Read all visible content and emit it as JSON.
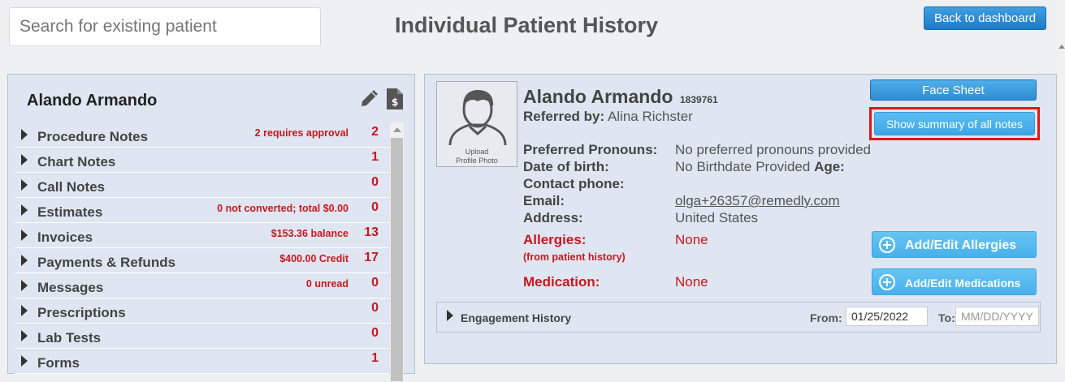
{
  "search": {
    "placeholder": "Search for existing patient"
  },
  "header": {
    "title": "Individual Patient History",
    "back_label": "Back to dashboard"
  },
  "left_panel": {
    "patient_name": "Alando Armando",
    "items": [
      {
        "label": "Procedure Notes",
        "note": "2 requires approval",
        "count": "2"
      },
      {
        "label": "Chart Notes",
        "note": "",
        "count": "1"
      },
      {
        "label": "Call Notes",
        "note": "",
        "count": "0"
      },
      {
        "label": "Estimates",
        "note": "0 not converted; total $0.00",
        "count": "0"
      },
      {
        "label": "Invoices",
        "note": "$153.36 balance",
        "count": "13"
      },
      {
        "label": "Payments & Refunds",
        "note": "$400.00 Credit",
        "count": "17"
      },
      {
        "label": "Messages",
        "note": "0 unread",
        "count": "0"
      },
      {
        "label": "Prescriptions",
        "note": "",
        "count": "0"
      },
      {
        "label": "Lab Tests",
        "note": "",
        "count": "0"
      },
      {
        "label": "Forms",
        "note": "",
        "count": "1"
      }
    ]
  },
  "patient": {
    "name": "Alando Armando",
    "id": "1839761",
    "referred_label": "Referred by:",
    "referred_value": "Alina Richster",
    "photo_label_1": "Upload",
    "photo_label_2": "Profile Photo",
    "pronouns_label": "Preferred Pronouns:",
    "pronouns_value": "No preferred pronouns provided",
    "dob_label": "Date of birth:",
    "dob_value": "No Birthdate Provided",
    "age_label": "Age:",
    "phone_label": "Contact phone:",
    "email_label": "Email:",
    "email_value": "olga+26357@remedly.com",
    "address_label": "Address:",
    "address_value": "United States",
    "allergies_label": "Allergies:",
    "allergies_sub": "(from patient history)",
    "allergies_value": "None",
    "medication_label": "Medication:",
    "medication_value": "None"
  },
  "actions": {
    "face_sheet": "Face Sheet",
    "summary": "Show summary of all notes",
    "add_allergies": "Add/Edit Allergies",
    "add_medications": "Add/Edit Medications"
  },
  "engagement": {
    "label": "Engagement History",
    "from_label": "From:",
    "from_value": "01/25/2022",
    "to_label": "To:",
    "to_placeholder": "MM/DD/YYYY"
  },
  "colors": {
    "accent_blue": "#1f7ac9",
    "alert_red": "#c8171e",
    "highlight_outline": "#e01616"
  }
}
